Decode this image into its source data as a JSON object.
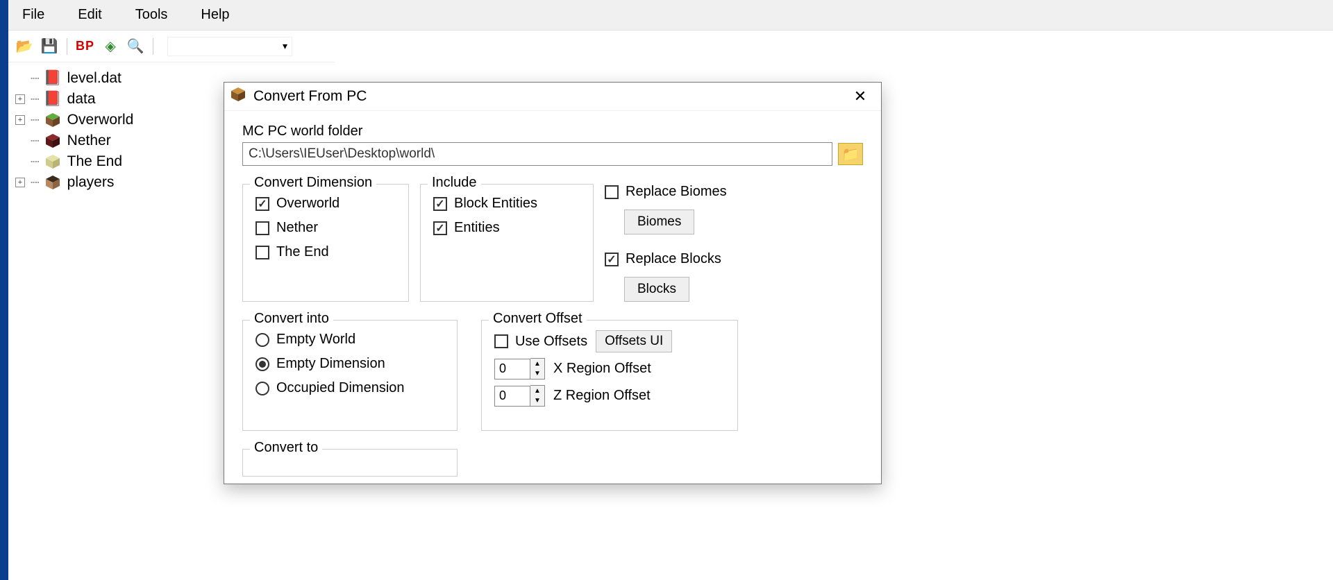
{
  "menu": {
    "file": "File",
    "edit": "Edit",
    "tools": "Tools",
    "help": "Help"
  },
  "toolbar": {
    "bp": "BP"
  },
  "tree": {
    "items": [
      {
        "label": "level.dat",
        "expandable": false,
        "color": "#7a4a2a"
      },
      {
        "label": "data",
        "expandable": true,
        "color": "#7a4a2a"
      },
      {
        "label": "Overworld",
        "expandable": true,
        "color": "#3a8f3a"
      },
      {
        "label": "Nether",
        "expandable": false,
        "color": "#7a1e1e"
      },
      {
        "label": "The End",
        "expandable": false,
        "color": "#d9d9a6"
      },
      {
        "label": "players",
        "expandable": true,
        "color": "#3a2a1a"
      }
    ]
  },
  "dialog": {
    "title": "Convert From PC",
    "folder_label": "MC PC world folder",
    "folder_value": "C:\\Users\\IEUser\\Desktop\\world\\",
    "convert_dimension": {
      "legend": "Convert Dimension",
      "overworld": {
        "label": "Overworld",
        "checked": true
      },
      "nether": {
        "label": "Nether",
        "checked": false
      },
      "the_end": {
        "label": "The End",
        "checked": false
      }
    },
    "include": {
      "legend": "Include",
      "block_entities": {
        "label": "Block Entities",
        "checked": true
      },
      "entities": {
        "label": "Entities",
        "checked": true
      }
    },
    "replace_biomes": {
      "label": "Replace Biomes",
      "checked": false,
      "button": "Biomes"
    },
    "replace_blocks": {
      "label": "Replace Blocks",
      "checked": true,
      "button": "Blocks"
    },
    "convert_into": {
      "legend": "Convert into",
      "options": [
        {
          "label": "Empty World",
          "selected": false
        },
        {
          "label": "Empty Dimension",
          "selected": true
        },
        {
          "label": "Occupied Dimension",
          "selected": false
        }
      ]
    },
    "convert_offset": {
      "legend": "Convert Offset",
      "use_offsets": {
        "label": "Use Offsets",
        "checked": false
      },
      "offsets_ui": "Offsets UI",
      "x": {
        "value": "0",
        "label": "X Region Offset"
      },
      "z": {
        "value": "0",
        "label": "Z Region Offset"
      }
    },
    "convert_to": {
      "legend": "Convert to"
    }
  }
}
